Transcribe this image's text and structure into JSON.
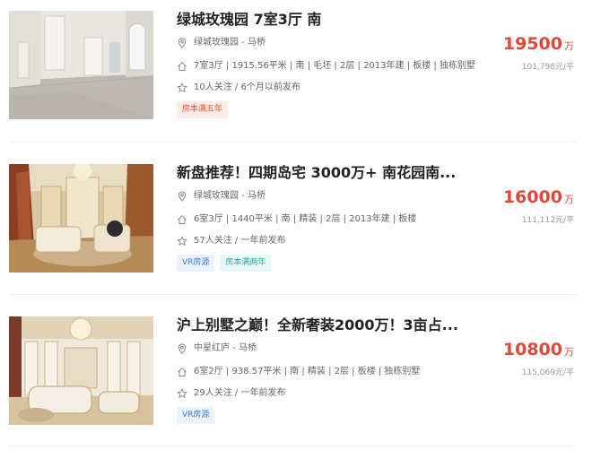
{
  "listings": [
    {
      "title": "绿城玫瑰园 7室3厅 南",
      "location": "绿城玫瑰园 - 马桥",
      "info": "7室3厅 | 1915.56平米 | 南 | 毛坯 | 2层 | 2013年建 | 板楼 | 独栋别墅",
      "follow": "10人关注 / 6个月以前发布",
      "tags": [
        "房本满五年"
      ],
      "price_total": "19500",
      "price_unit": "万",
      "price_per": "101,798元/平",
      "image": "empty-villa-interior-photo"
    },
    {
      "title": "新盘推荐！四期岛宅 3000万+ 南花园南...",
      "location": "绿城玫瑰园 - 马桥",
      "info": "6室3厅 | 1440平米 | 南 | 精装 | 2层 | 2013年建 | 板楼",
      "follow": "57人关注 / 一年前发布",
      "tags": [
        "VR房源",
        "房本满两年"
      ],
      "price_total": "16000",
      "price_unit": "万",
      "price_per": "111,112元/平",
      "image": "luxury-living-room-photo"
    },
    {
      "title": "沪上别墅之巅！全新奢装2000万！3亩占...",
      "location": "中星红庐 - 马桥",
      "info": "6室2厅 | 938.57平米 | 南 | 精装 | 2层 | 板楼 | 独栋别墅",
      "follow": "29人关注 / 一年前发布",
      "tags": [
        "VR房源"
      ],
      "price_total": "10800",
      "price_unit": "万",
      "price_per": "115,069元/平",
      "image": "ornate-hall-photo"
    }
  ],
  "icons": {
    "location": "location-pin-icon",
    "house": "house-icon",
    "follow": "star-icon"
  },
  "colors": {
    "price": "#e2483a",
    "tag_red": "#e2563b",
    "tag_blue": "#3d7fcc",
    "tag_cyan": "#2fa8a0"
  }
}
